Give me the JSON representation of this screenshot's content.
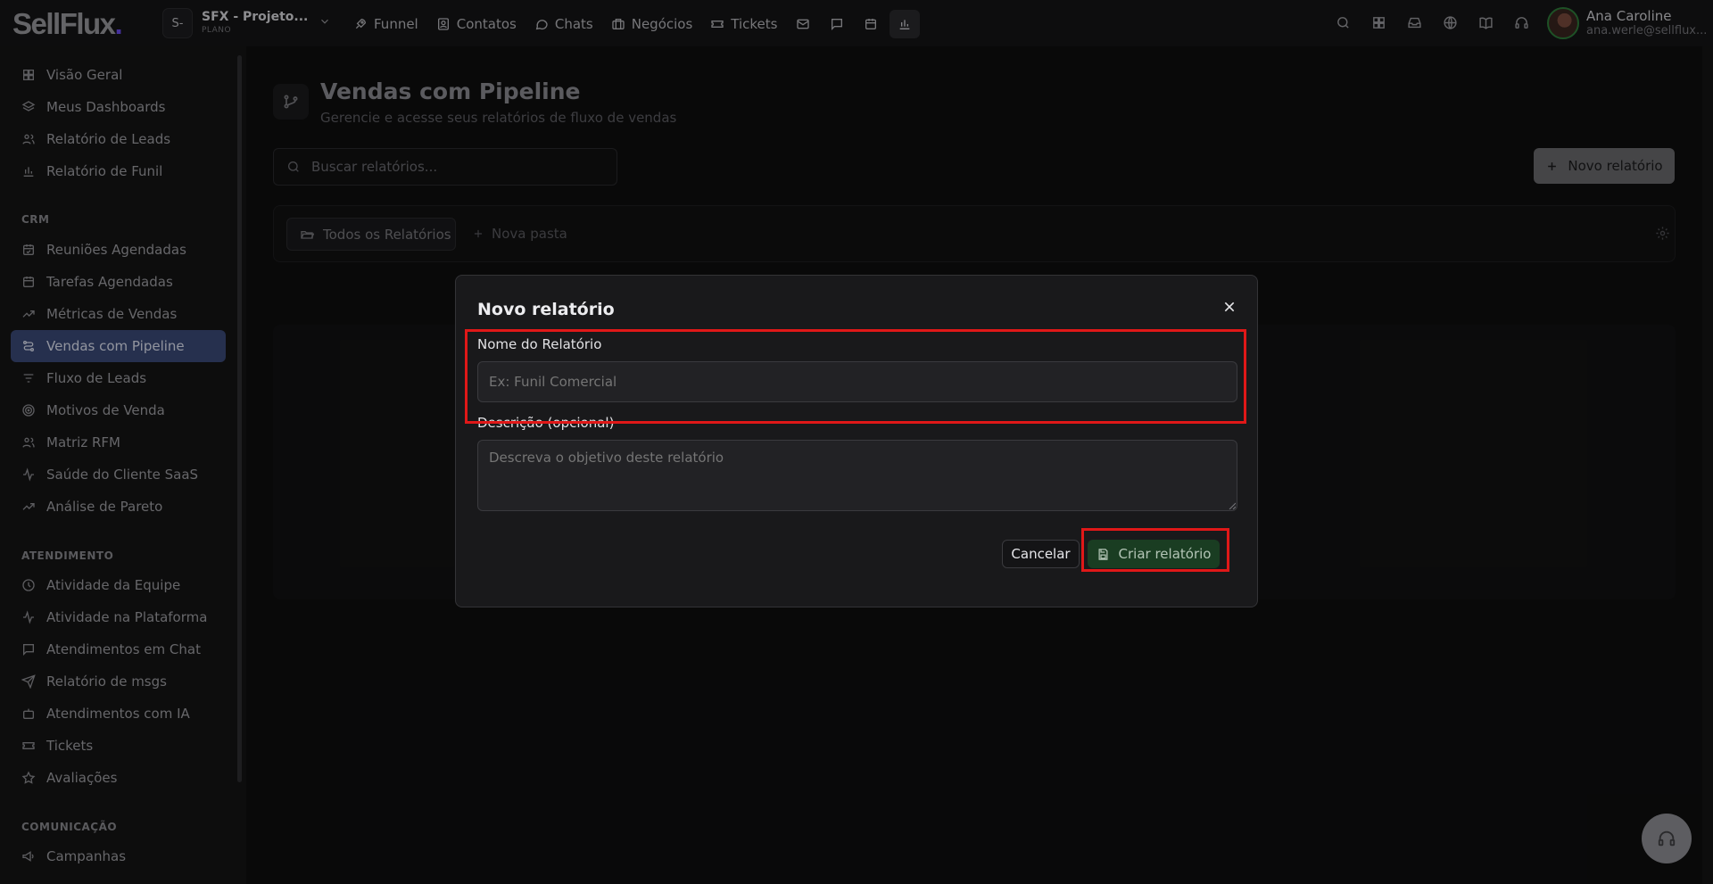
{
  "brand": {
    "logo_text": "SellFlux",
    "logo_dot": ".",
    "accent": "#6a4cf0"
  },
  "workspace": {
    "initial": "S-",
    "name": "SFX - Projeto...",
    "plan": "PLANO"
  },
  "topnav": {
    "items": [
      {
        "label": "Funnel",
        "icon": "rocket-icon"
      },
      {
        "label": "Contatos",
        "icon": "contacts-icon"
      },
      {
        "label": "Chats",
        "icon": "chat-bubble-icon"
      },
      {
        "label": "Negócios",
        "icon": "briefcase-icon"
      },
      {
        "label": "Tickets",
        "icon": "ticket-icon"
      }
    ],
    "icon_buttons": [
      "mail-icon",
      "message-square-icon",
      "calendar-icon",
      "bar-chart-icon"
    ]
  },
  "header_right_icons": [
    "search-icon",
    "grid-icon",
    "inbox-icon",
    "globe-icon",
    "book-icon",
    "headset-icon"
  ],
  "user": {
    "name": "Ana Caroline",
    "email": "ana.werle@sellflux..."
  },
  "sidebar": {
    "group_top": [
      {
        "label": "Visão Geral",
        "icon": "grid-icon"
      },
      {
        "label": "Meus Dashboards",
        "icon": "layers-icon"
      },
      {
        "label": "Relatório de Leads",
        "icon": "users-icon"
      },
      {
        "label": "Relatório de Funil",
        "icon": "bar-chart-icon"
      }
    ],
    "crm_title": "CRM",
    "crm": [
      {
        "label": "Reuniões Agendadas",
        "icon": "calendar-check-icon"
      },
      {
        "label": "Tarefas Agendadas",
        "icon": "calendar-icon"
      },
      {
        "label": "Métricas de Vendas",
        "icon": "trending-up-icon"
      },
      {
        "label": "Vendas com Pipeline",
        "icon": "pipeline-icon",
        "active": true
      },
      {
        "label": "Fluxo de Leads",
        "icon": "list-filter-icon"
      },
      {
        "label": "Motivos de Venda",
        "icon": "target-icon"
      },
      {
        "label": "Matriz RFM",
        "icon": "users-icon"
      },
      {
        "label": "Saúde do Cliente SaaS",
        "icon": "activity-icon"
      },
      {
        "label": "Análise de Pareto",
        "icon": "trending-up-icon"
      }
    ],
    "atendimento_title": "ATENDIMENTO",
    "atendimento": [
      {
        "label": "Atividade da Equipe",
        "icon": "clock-icon"
      },
      {
        "label": "Atividade na Plataforma",
        "icon": "activity-icon"
      },
      {
        "label": "Atendimentos em Chat",
        "icon": "message-square-icon"
      },
      {
        "label": "Relatório de msgs",
        "icon": "send-icon"
      },
      {
        "label": "Atendimentos com IA",
        "icon": "bot-icon"
      },
      {
        "label": "Tickets",
        "icon": "ticket-icon"
      },
      {
        "label": "Avaliações",
        "icon": "star-icon"
      }
    ],
    "comunicacao_title": "COMUNICAÇÃO",
    "comunicacao": [
      {
        "label": "Campanhas",
        "icon": "megaphone-icon"
      }
    ]
  },
  "page": {
    "title": "Vendas com Pipeline",
    "subtitle": "Gerencie e acesse seus relatórios de fluxo de vendas",
    "search_placeholder": "Buscar relatórios...",
    "new_report_label": "Novo relatório",
    "folder_all_label": "Todos os Relatórios",
    "new_folder_label": "Nova pasta"
  },
  "modal": {
    "title": "Novo relatório",
    "name_label": "Nome do Relatório",
    "name_placeholder": "Ex: Funil Comercial",
    "name_value": "",
    "desc_label": "Descrição (opcional)",
    "desc_placeholder": "Descreva o objetivo deste relatório",
    "desc_value": "",
    "cancel_label": "Cancelar",
    "create_label": "Criar relatório"
  },
  "colors": {
    "active_nav": "#3b4a78",
    "create_button": "#1a3d22",
    "highlight": "#e01818"
  }
}
